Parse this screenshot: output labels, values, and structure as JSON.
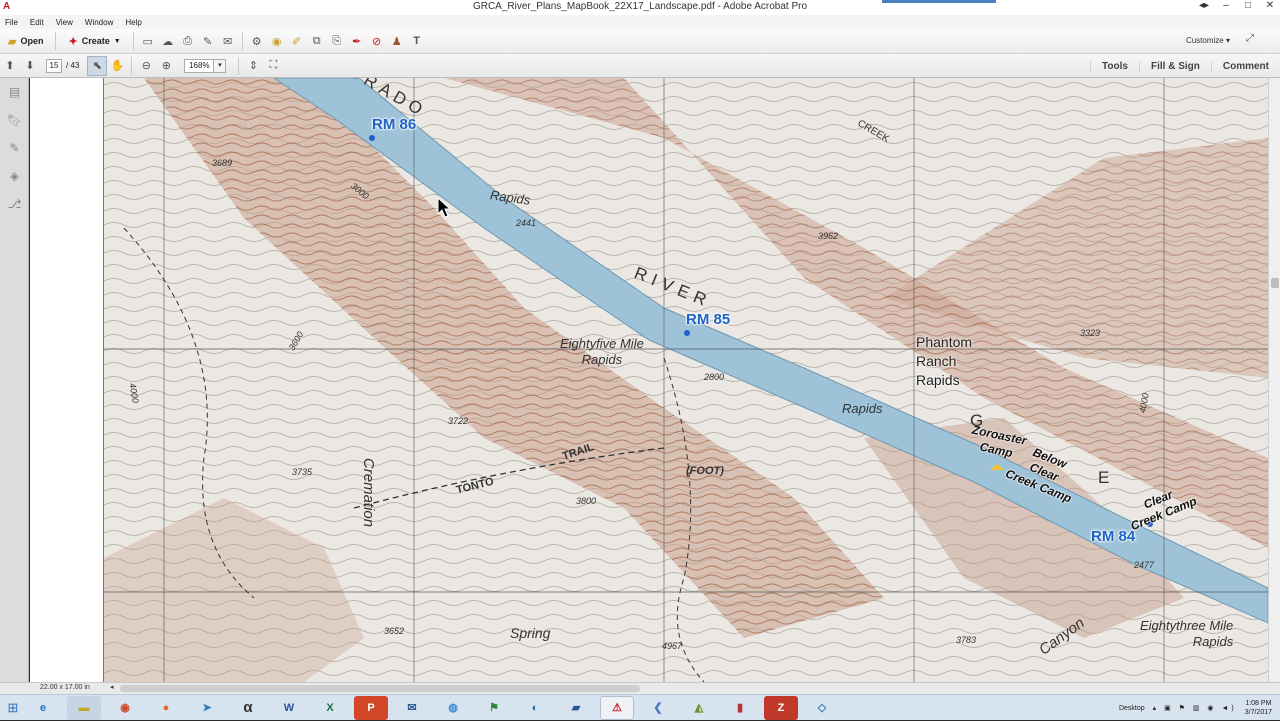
{
  "window": {
    "title": "GRCA_River_Plans_MapBook_22X17_Landscape.pdf - Adobe Acrobat Pro",
    "app_icon": "acrobat-icon",
    "buttons": [
      "minimize-icon",
      "maximize-icon",
      "close-icon"
    ]
  },
  "menu": [
    "File",
    "Edit",
    "View",
    "Window",
    "Help"
  ],
  "toolbar": {
    "open_label": "Open",
    "create_label": "Create",
    "customize_label": "Customize"
  },
  "nav": {
    "page_current": "15",
    "page_total": "/ 43",
    "zoom": "168%"
  },
  "panes": {
    "tools": "Tools",
    "fill_sign": "Fill & Sign",
    "comment": "Comment"
  },
  "map": {
    "river_miles": [
      "RM 86",
      "RM 85",
      "RM 84"
    ],
    "rapids_upper": "Rapids",
    "rapids_85": "Eightyfive Mile\nRapids",
    "phantom": "Phantom\nRanch\nRapids",
    "rapids_lower": "Rapids",
    "zoroaster": "Zoroaster\nCamp",
    "below_clear": "Below\nClear\nCreek Camp",
    "clear_creek": "Clear\nCreek Camp",
    "river_name": "RIVER",
    "colorado_fragment": "LORADO",
    "granite_fragment": "G",
    "granite_e": "E",
    "creek": "CREEK",
    "cremation": "Cremation",
    "tonto": "TONTO",
    "trail": "TRAIL",
    "foot": "(FOOT)",
    "spring": "Spring",
    "canyon": "Canyon",
    "eightythree": "Eightythree Mile\nRapids",
    "elevations": [
      "3689",
      "2441",
      "3962",
      "3722",
      "3735",
      "3800",
      "2800",
      "3652",
      "4967",
      "3783",
      "2477",
      "3323",
      "3600",
      "4000",
      "4000",
      "3000"
    ]
  },
  "status": {
    "page_size": "22.00 x 17.00 in"
  },
  "taskbar": {
    "apps": [
      "windows-start-icon",
      "ie-icon",
      "explorer-icon",
      "chrome-icon",
      "firefox-icon",
      "app-icon",
      "alpha-icon",
      "word-icon",
      "excel-icon",
      "powerpoint-icon",
      "thunderbird-icon",
      "globe-icon",
      "map-icon",
      "earth-icon",
      "app-icon",
      "acrobat-icon",
      "app-icon",
      "app-icon",
      "app-icon",
      "filezilla-icon",
      "app-icon"
    ],
    "desktop_label": "Desktop",
    "time": "1:08 PM",
    "date": "3/7/2017"
  },
  "colors": {
    "river": "#9ec3d8",
    "rm_blue": "#1d62c5",
    "contour": "#a0522d"
  }
}
